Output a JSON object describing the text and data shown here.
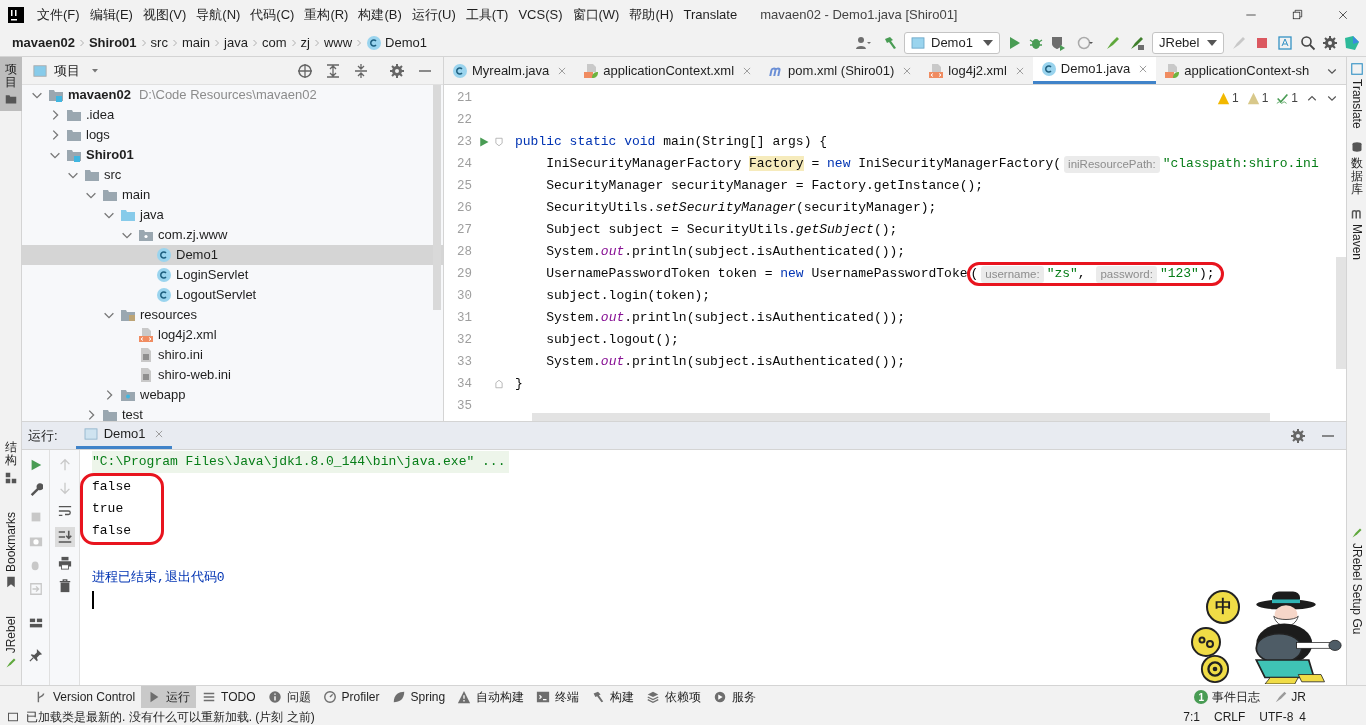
{
  "menu_bar": {
    "items": [
      "文件(F)",
      "编辑(E)",
      "视图(V)",
      "导航(N)",
      "代码(C)",
      "重构(R)",
      "构建(B)",
      "运行(U)",
      "工具(T)",
      "VCS(S)",
      "窗口(W)",
      "帮助(H)",
      "Translate"
    ],
    "title": "mavaen02 - Demo1.java [Shiro01]"
  },
  "breadcrumbs": [
    {
      "label": "mavaen02",
      "kind": "project"
    },
    {
      "label": "Shiro01",
      "kind": "project"
    },
    {
      "label": "src",
      "kind": "folder"
    },
    {
      "label": "main",
      "kind": "folder"
    },
    {
      "label": "java",
      "kind": "folder"
    },
    {
      "label": "com",
      "kind": "folder"
    },
    {
      "label": "zj",
      "kind": "folder"
    },
    {
      "label": "www",
      "kind": "folder"
    },
    {
      "label": "Demo1",
      "kind": "class"
    }
  ],
  "toolbar": {
    "run_config": "Demo1",
    "jrebel": "JRebel"
  },
  "left_strip": [
    {
      "label": "项目",
      "selected": true,
      "kind": "stacked"
    },
    {
      "label": "结构",
      "selected": false,
      "kind": "stacked"
    },
    {
      "label": "Bookmarks",
      "selected": false,
      "kind": "rotated"
    },
    {
      "label": "JRebel",
      "selected": false,
      "kind": "rotated"
    }
  ],
  "right_strip": [
    {
      "label": "Translate",
      "kind": "rotated"
    },
    {
      "label": "数据库",
      "kind": "stacked"
    },
    {
      "label": "Maven",
      "kind": "rotated"
    },
    {
      "label": "JRebel Setup Gu",
      "kind": "rotated"
    }
  ],
  "project_panel": {
    "title": "项目",
    "tree": [
      {
        "label": "mavaen02",
        "kind": "module",
        "note": "D:\\Code Resources\\mavaen02",
        "expanded": true,
        "selected": false,
        "children": [
          {
            "label": ".idea",
            "kind": "folder",
            "expanded": false,
            "selected": false
          },
          {
            "label": "logs",
            "kind": "folder",
            "expanded": false,
            "selected": false
          },
          {
            "label": "Shiro01",
            "kind": "module",
            "expanded": true,
            "selected": false,
            "children": [
              {
                "label": "src",
                "kind": "folder",
                "expanded": true,
                "selected": false,
                "children": [
                  {
                    "label": "main",
                    "kind": "folder",
                    "expanded": true,
                    "selected": false,
                    "children": [
                      {
                        "label": "java",
                        "kind": "source",
                        "expanded": true,
                        "selected": false,
                        "children": [
                          {
                            "label": "com.zj.www",
                            "kind": "package",
                            "expanded": true,
                            "selected": false,
                            "children": [
                              {
                                "label": "Demo1",
                                "kind": "class",
                                "selected": true
                              },
                              {
                                "label": "LoginServlet",
                                "kind": "class",
                                "selected": false
                              },
                              {
                                "label": "LogoutServlet",
                                "kind": "class",
                                "selected": false
                              }
                            ]
                          }
                        ]
                      },
                      {
                        "label": "resources",
                        "kind": "resources",
                        "expanded": true,
                        "selected": false,
                        "children": [
                          {
                            "label": "log4j2.xml",
                            "kind": "xml",
                            "selected": false
                          },
                          {
                            "label": "shiro.ini",
                            "kind": "text",
                            "selected": false
                          },
                          {
                            "label": "shiro-web.ini",
                            "kind": "text",
                            "selected": false
                          }
                        ]
                      },
                      {
                        "label": "webapp",
                        "kind": "web",
                        "expanded": false,
                        "selected": false
                      }
                    ]
                  },
                  {
                    "label": "test",
                    "kind": "folder",
                    "expanded": false,
                    "selected": false
                  }
                ]
              }
            ]
          }
        ]
      }
    ]
  },
  "editor": {
    "tabs": [
      {
        "label": "Myrealm.java",
        "kind": "class",
        "selected": false,
        "closable": true
      },
      {
        "label": "applicationContext.xml",
        "kind": "spring",
        "selected": false,
        "closable": true
      },
      {
        "label": "pom.xml (Shiro01)",
        "kind": "maven",
        "selected": false,
        "closable": true
      },
      {
        "label": "log4j2.xml",
        "kind": "xml",
        "selected": false,
        "closable": true
      },
      {
        "label": "Demo1.java",
        "kind": "class",
        "selected": true,
        "closable": true
      },
      {
        "label": "applicationContext-sh",
        "kind": "spring",
        "selected": false,
        "closable": false
      }
    ],
    "inspections": [
      {
        "kind": "warning",
        "count": "1"
      },
      {
        "kind": "weak",
        "count": "1"
      },
      {
        "kind": "typo",
        "count": "1"
      }
    ],
    "lines": [
      {
        "number": "21"
      },
      {
        "number": "22"
      },
      {
        "number": "23",
        "run_marker": true,
        "fold_start": true,
        "tokens": [
          {
            "text": "public static void",
            "kind": "keyword"
          },
          {
            "text": " main(String[] args) {",
            "kind": "plain"
          }
        ]
      },
      {
        "number": "24",
        "tokens": [
          {
            "text": "    IniSecurityManagerFactory ",
            "kind": "plain"
          },
          {
            "text": "Factory",
            "kind": "highlight"
          },
          {
            "text": " = ",
            "kind": "plain"
          },
          {
            "text": "new",
            "kind": "keyword"
          },
          {
            "text": " IniSecurityManagerFactory(",
            "kind": "plain"
          },
          {
            "text": "iniResourcePath:",
            "kind": "hint"
          },
          {
            "text": "\"classpath:shiro.ini",
            "kind": "string"
          }
        ]
      },
      {
        "number": "25",
        "tokens": [
          {
            "text": "    SecurityManager securityManager = Factory.getInstance();",
            "kind": "plain"
          }
        ]
      },
      {
        "number": "26",
        "tokens": [
          {
            "text": "    SecurityUtils.",
            "kind": "plain"
          },
          {
            "text": "setSecurityManager",
            "kind": "static"
          },
          {
            "text": "(securityManager);",
            "kind": "plain"
          }
        ]
      },
      {
        "number": "27",
        "tokens": [
          {
            "text": "    Subject subject = SecurityUtils.",
            "kind": "plain"
          },
          {
            "text": "getSubject",
            "kind": "static"
          },
          {
            "text": "();",
            "kind": "plain"
          }
        ]
      },
      {
        "number": "28",
        "tokens": [
          {
            "text": "    System.",
            "kind": "plain"
          },
          {
            "text": "out",
            "kind": "field"
          },
          {
            "text": ".println(subject.isAuthenticated());",
            "kind": "plain"
          }
        ]
      },
      {
        "number": "29",
        "tokens": [
          {
            "text": "    UsernamePasswordToken token = ",
            "kind": "plain"
          },
          {
            "text": "new",
            "kind": "keyword"
          },
          {
            "text": " UsernamePasswordToke",
            "kind": "plain"
          }
        ],
        "circled": [
          {
            "text": "(",
            "kind": "plain"
          },
          {
            "text": "username:",
            "kind": "hint"
          },
          {
            "text": "\"zs\"",
            "kind": "string"
          },
          {
            "text": ", ",
            "kind": "plain"
          },
          {
            "text": "password:",
            "kind": "hint"
          },
          {
            "text": "\"123\"",
            "kind": "string"
          },
          {
            "text": ");",
            "kind": "plain"
          }
        ]
      },
      {
        "number": "30",
        "tokens": [
          {
            "text": "    subject.login(token);",
            "kind": "plain"
          }
        ]
      },
      {
        "number": "31",
        "tokens": [
          {
            "text": "    System.",
            "kind": "plain"
          },
          {
            "text": "out",
            "kind": "field"
          },
          {
            "text": ".println(subject.isAuthenticated());",
            "kind": "plain"
          }
        ]
      },
      {
        "number": "32",
        "tokens": [
          {
            "text": "    subject.logout();",
            "kind": "plain"
          }
        ]
      },
      {
        "number": "33",
        "tokens": [
          {
            "text": "    System.",
            "kind": "plain"
          },
          {
            "text": "out",
            "kind": "field"
          },
          {
            "text": ".println(subject.isAuthenticated());",
            "kind": "plain"
          }
        ]
      },
      {
        "number": "34",
        "fold_end": true,
        "tokens": [
          {
            "text": "}",
            "kind": "plain"
          }
        ]
      },
      {
        "number": "35"
      }
    ]
  },
  "run_panel": {
    "label": "运行:",
    "tabs": [
      {
        "label": "Demo1",
        "selected": true
      }
    ],
    "console": [
      {
        "text": "\"C:\\Program Files\\Java\\jdk1.8.0_144\\bin\\java.exe\" ...",
        "kind": "command",
        "circled": false
      },
      {
        "text": "false",
        "kind": "output",
        "circled": true
      },
      {
        "text": "true",
        "kind": "output",
        "circled": true
      },
      {
        "text": "false",
        "kind": "output",
        "circled": true
      },
      {
        "text": "进程已结束,退出代码0",
        "kind": "exit",
        "circled": false
      }
    ]
  },
  "tool_windows": [
    {
      "label": "Version Control",
      "selected": false
    },
    {
      "label": "运行",
      "selected": true
    },
    {
      "label": "TODO",
      "selected": false
    },
    {
      "label": "问题",
      "selected": false
    },
    {
      "label": "Profiler",
      "selected": false
    },
    {
      "label": "Spring",
      "selected": false
    },
    {
      "label": "自动构建",
      "selected": false
    },
    {
      "label": "终端",
      "selected": false
    },
    {
      "label": "构建",
      "selected": false
    },
    {
      "label": "依赖项",
      "selected": false
    },
    {
      "label": "服务",
      "selected": false
    }
  ],
  "event_log": {
    "label": "事件日志",
    "badge": "1"
  },
  "jrebel_console": {
    "label": "JR"
  },
  "ime": {
    "mode": "中"
  },
  "status_bar": {
    "message": "已加载类是最新的. 没有什么可以重新加载. (片刻 之前)",
    "items": [
      "7:1",
      "CRLF",
      "UTF-8",
      "4"
    ]
  }
}
